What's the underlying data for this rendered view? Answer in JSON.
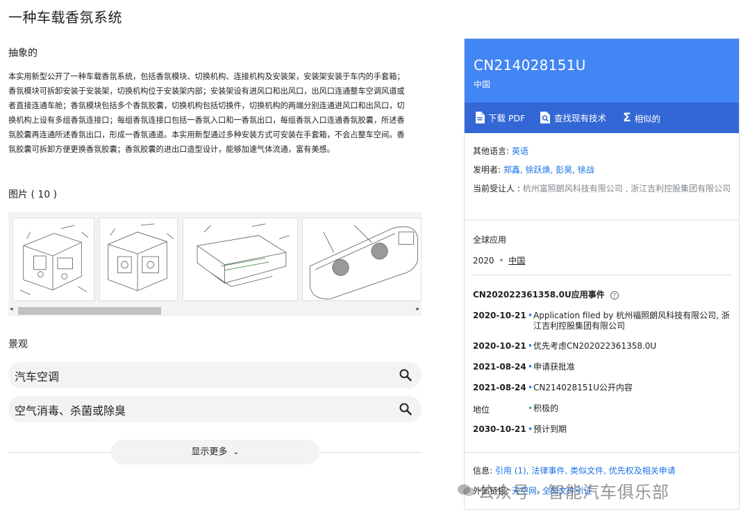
{
  "title": "一种车载香氛系统",
  "abstract": {
    "heading": "抽象的",
    "text": "本实用新型公开了一种车载香氛系统，包括香氛模块、切换机构、连接机构及安装架，安装架安装于车内的手套箱；香氛模块可拆卸安装于安装架，切换机构位于安装架内部；安装架设有进风口和出风口，出风口连通整车空调风道或者直接连通车舱；香氛模块包括多个香氛胶囊，切换机构包括切换件，切换机构的两端分别连通进风口和出风口，切换机构上设有多组香氛连接口；每组香氛连接口包括一香氛入口和一香氛出口，每组香氛入口连通香氛胶囊，所述香氛胶囊再连通所述香氛出口，形成一香氛通道。本实用新型通过多种安装方式可安装在手套箱，不会占整车空间。香氛胶囊可拆卸方便更换香氛胶囊；香氛胶囊的进出口造型设计，能够加速气体流通，富有美感。"
  },
  "images": {
    "heading": "图片 ( 10 )",
    "scroll_left": "◂",
    "scroll_right": "▸"
  },
  "landscape": {
    "heading": "景观",
    "concepts": [
      {
        "label": "汽车空调"
      },
      {
        "label": "空气消毒、杀菌或除臭"
      }
    ],
    "show_more": "显示更多",
    "show_more_icon": "chevron-down-icon"
  },
  "panel": {
    "pub_number": "CN214028151U",
    "country": "中国",
    "actions": {
      "download": "下载 PDF",
      "prior_art": "查找现有技术",
      "similar": "相似的"
    },
    "other_lang_label": "其他语言:",
    "other_lang_value": "英语",
    "inventors_label": "发明者:",
    "inventors": "郑鑫, 徐跃焕, 彭昊, 徐战",
    "assignee_label": "当前受让人 :",
    "assignee_value": "杭州富照朗风科技有限公司 , 浙江吉利控股集团有限公司",
    "global_label": "全球应用",
    "global_year": "2020",
    "global_dot": "•",
    "global_country": "中国",
    "events_title": "CN202022361358.0U应用事件",
    "events_help_icon": "help-circle-icon",
    "events": [
      {
        "date": "2020-10-21",
        "text": "Application filed by 杭州福照朗风科技有限公司, 浙江吉利控股集团有限公司"
      },
      {
        "date": "2020-10-21",
        "text": "优先考虑CN202022361358.0U"
      },
      {
        "date": "2021-08-24",
        "text": "申请获批准"
      },
      {
        "date": "2021-08-24",
        "text": "CN214028151U公开内容"
      },
      {
        "date": "地位",
        "text": "积极的"
      },
      {
        "date": "2030-10-21",
        "text": "预计到期"
      }
    ],
    "info_label": "信息:",
    "info_links": "引用 (1), 法律事件, 类似文件, 优先权及相关申请",
    "external_label": "外部链接:",
    "external_links": "天空网, 全局文件引证"
  },
  "watermark": "公众号 · 智能汽车俱乐部",
  "colors": {
    "header_blue": "#4285f4",
    "actions_blue": "#3367d6",
    "link": "#1a73e8"
  }
}
